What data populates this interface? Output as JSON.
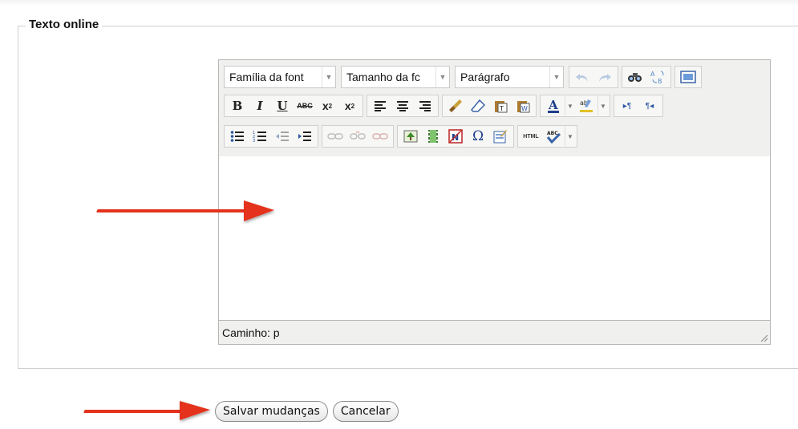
{
  "form": {
    "legend": "Texto online"
  },
  "editor": {
    "font_family": "Família da font",
    "font_size": "Tamanho da fc",
    "format": "Parágrafo",
    "path_label": "Caminho: p"
  },
  "actions": {
    "save_label": "Salvar mudanças",
    "cancel_label": "Cancelar"
  },
  "colors": {
    "arrow": "#e4331c",
    "toolbar_bg": "#f0f0ee",
    "border": "#b6b6b6"
  }
}
